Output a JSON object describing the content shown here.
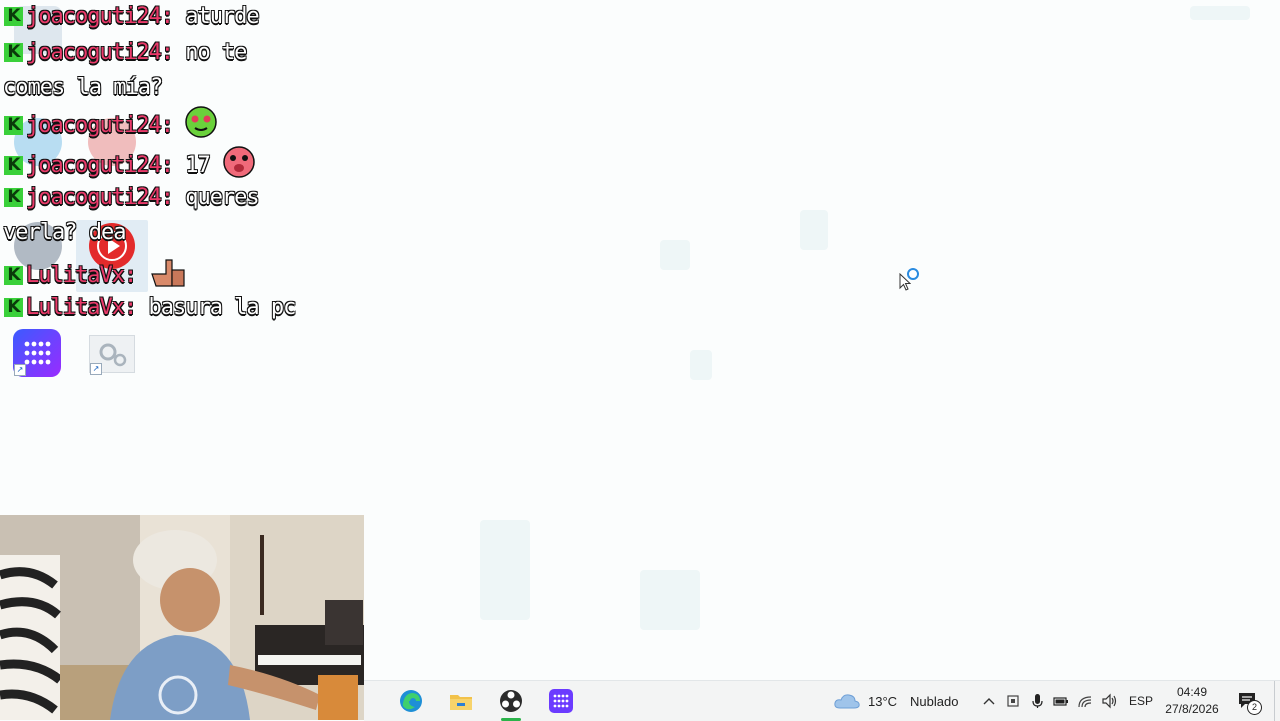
{
  "chat": {
    "messages": [
      {
        "user": "joacoguti24:",
        "text": " aturde"
      },
      {
        "user": "joacoguti24:",
        "text": " no te"
      },
      {
        "user": "",
        "text": "comes la mía?"
      },
      {
        "user": "joacoguti24:",
        "text": " "
      },
      {
        "user": "joacoguti24:",
        "text": " 17 "
      },
      {
        "user": "joacoguti24:",
        "text": " queres"
      },
      {
        "user": "",
        "text": "verla? dea"
      },
      {
        "user": "LulitaVx:",
        "text": " "
      },
      {
        "user": "LulitaVx:",
        "text": " basura la pc"
      }
    ],
    "badge": "K",
    "user_color": "#ea3a6a"
  },
  "taskbar": {
    "apps": [
      "edge-icon",
      "file-explorer-icon",
      "obs-icon",
      "app-grid-icon"
    ],
    "weather": {
      "temp": "13°C",
      "condition": "Nublado"
    },
    "language": "ESP",
    "time": "04:49",
    "date": "27/8/2026",
    "notification_count": "2"
  },
  "accent": "#2bb34a"
}
